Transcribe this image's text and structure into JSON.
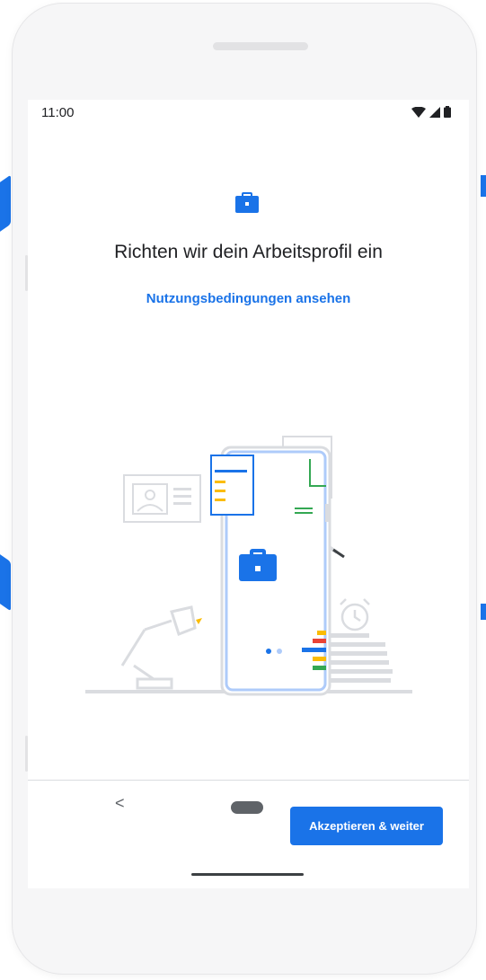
{
  "status_bar": {
    "time": "11:00",
    "icons": [
      "wifi-icon",
      "cell-signal-icon",
      "battery-icon"
    ]
  },
  "setup": {
    "icon": "briefcase-icon",
    "title": "Richten wir dein Arbeitsprofil ein",
    "terms_link": "Nutzungsbedingungen ansehen"
  },
  "illustration": {
    "page_indicator": {
      "count": 2,
      "active": 0
    }
  },
  "nav": {
    "back_label": "<",
    "accept_label": "Akzeptieren & weiter"
  },
  "colors": {
    "accent": "#1a73e8",
    "text": "#202124",
    "illustration_gray": "#dadce0",
    "yellow": "#fbbc04",
    "red": "#ea4335",
    "green": "#34a853"
  }
}
